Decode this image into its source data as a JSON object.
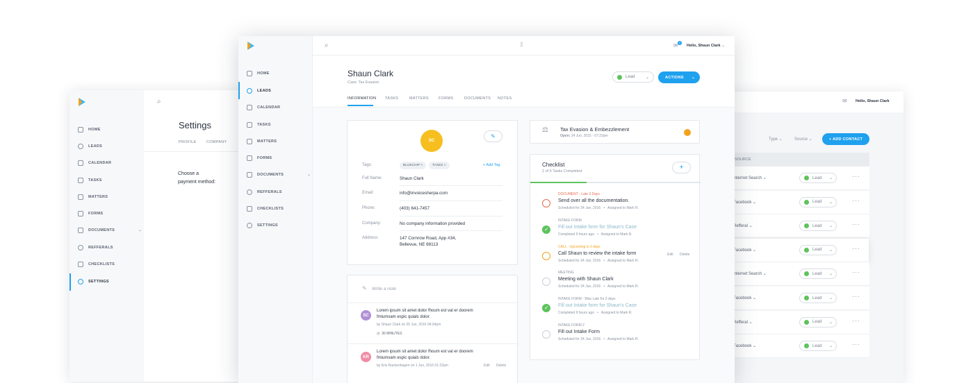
{
  "user_greeting": "Hello, Shaun Clark",
  "notification_count": "1",
  "settings_window": {
    "nav": [
      "HOME",
      "LEADS",
      "CALENDAR",
      "TASKS",
      "MATTERS",
      "FORMS",
      "DOCUMENTS",
      "REFFERALS",
      "CHECKLISTS",
      "SETTINGS"
    ],
    "title": "Settings",
    "tabs": [
      "PROFILE",
      "COMPANY"
    ],
    "payment_label_1": "Choose a",
    "payment_label_2": "payment method:"
  },
  "list_window": {
    "filter_type": "Type",
    "filter_source": "Source",
    "add_contact": "+ ADD CONTACT",
    "source_header": "SOURCE",
    "rows": [
      {
        "source": "Internet Search",
        "status": "Lead"
      },
      {
        "source": "Facebook",
        "status": "Lead"
      },
      {
        "source": "Refferal",
        "status": "Lead"
      },
      {
        "source": "Facebook",
        "status": "Lead"
      },
      {
        "source": "Internet Search",
        "status": "Lead"
      },
      {
        "source": "Facebook",
        "status": "Lead"
      },
      {
        "source": "Refferal",
        "status": "Lead"
      },
      {
        "source": "Facebook",
        "status": "Lead"
      }
    ]
  },
  "main": {
    "nav": [
      "HOME",
      "LEADS",
      "CALENDAR",
      "TASKS",
      "MATTERS",
      "FORMS",
      "DOCUMENTS",
      "REFFERALS",
      "CHECKLISTS",
      "SETTINGS"
    ],
    "name": "Shaun Clark",
    "case": "Case: Tax Evasion",
    "status": "Lead",
    "actions": "ACTIONS",
    "tabs": [
      "INFORMATION",
      "TASKS",
      "MATTERS",
      "FORMS",
      "DOCUMENTS",
      "NOTES"
    ],
    "initials": "SC",
    "tags_label": "Tags:",
    "tags": [
      "BLUECHIP",
      "TAXES"
    ],
    "add_tag": "+ Add Tag",
    "fields": [
      {
        "label": "Full Name:",
        "value": "Shaun Clark"
      },
      {
        "label": "Email:",
        "value": "info@invoicesherpa.com"
      },
      {
        "label": "Phone:",
        "value": "(403) 641-7457"
      },
      {
        "label": "Company:",
        "value": "No company information provided"
      },
      {
        "label": "Address:",
        "value": "147 Cornrow Road, App #34,",
        "value2": "Bellevue, NE 68113"
      }
    ],
    "note_placeholder": "Write a note",
    "notes": [
      {
        "initials": "SC",
        "text1": "Lorem ipsum sit amet dolor fhoum est val er doorem",
        "text2": "fmiumxam espic quials dolor.",
        "meta": "by Shaun Clark on 25 Jun, 2016 04:34pm",
        "duration": "30 MINUTES"
      },
      {
        "initials": "KR",
        "text1": "Lorem ipsum sit amet dolor fhoum est val er doorem",
        "text2": "fmiumxam espic quials dolor.",
        "meta": "by Kris Rackenhagen on 1 Jun, 2016 01:22pm",
        "edit": "Edit",
        "delete": "Delete"
      }
    ],
    "matter_title": "Tax Evasion & Embezzlement",
    "matter_open": "Open:",
    "matter_date": "24 Jun, 2015 - 07:22pm",
    "checklist_title": "Checklist",
    "checklist_sub": "2 of 6 Tasks Completed",
    "checklist_progress": 0.33,
    "items": [
      {
        "cat": "DOCUMENT",
        "cat_note": " - Late 3 Days",
        "title": "Send over all the documentation.",
        "meta": "Scheduled for 24 Jun, 2016   •   Assigned to Mark R.",
        "state": "late"
      },
      {
        "cat": "INTAKE FORM",
        "cat_note": "",
        "title": "Fill out Intake form for Shaun's Case",
        "meta": "Completed 9 hours ago   •   Assigned to Mark R.",
        "state": "done"
      },
      {
        "cat": "CALL",
        "cat_note": " - Upcoming in 2 days",
        "title": "Call Shaun to review the intake form",
        "meta": "Scheduled for 24 Jun, 2016   •   Assigned to Mark R.",
        "state": "upcoming",
        "edit": "Edit",
        "delete": "Delete"
      },
      {
        "cat": "MEETING",
        "cat_note": "",
        "title": "Meeting with Shaun Clark",
        "meta": "Scheduled for 24 Jun, 2016   •   Assigned to Mark R.",
        "state": "open"
      },
      {
        "cat": "INTAKE FORM",
        "cat_note": " - Was Late for 3 days",
        "title": "Fill out Intake form for Shaun's Case",
        "meta": "Completed 9 hours ago   •   Assigned to Mark R.",
        "state": "done"
      },
      {
        "cat": "INTAKE FORM 2",
        "cat_note": "",
        "title": "Fill out Intake Form",
        "meta": "Scheduled for 24 Jun, 2016   •   Assigned to Mark R.",
        "state": "open"
      }
    ]
  }
}
